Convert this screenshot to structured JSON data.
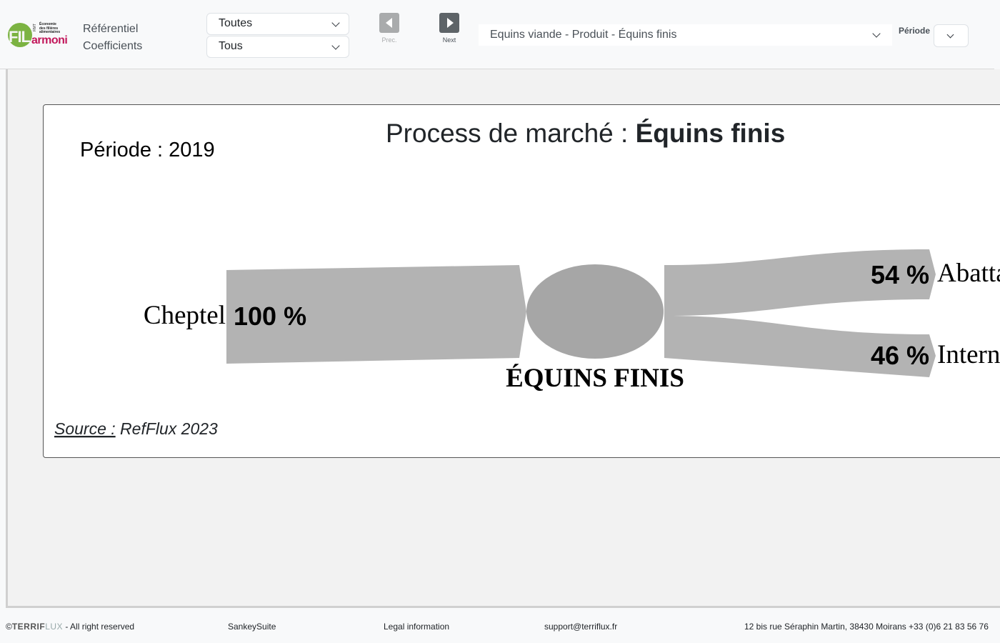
{
  "header": {
    "logo": {
      "badge": "FIL",
      "rmt": "RMT",
      "lines": [
        "Économie",
        "des filières",
        "alimentaires"
      ],
      "wordmark": "armoni"
    },
    "nav": {
      "referentiel": "Référentiel",
      "coefficients": "Coefficients"
    },
    "filter1": "Toutes",
    "filter2": "Tous",
    "prev_label": "Prec.",
    "next_label": "Next",
    "product_select": "Equins viande - Produit - Équins finis",
    "periode_label": "Période",
    "periode_value": ""
  },
  "diagram": {
    "period_label": "Période : 2019",
    "title_prefix": "Process de marché : ",
    "title_bold": "Équins finis",
    "node_label": "ÉQUINS FINIS",
    "source_label": "Source :",
    "source_value": " RefFlux 2023",
    "flows": {
      "input": {
        "label": "Cheptel",
        "percent": "100 %"
      },
      "out1": {
        "label": "Abattage",
        "percent": "54 %"
      },
      "out2": {
        "label": "International",
        "percent": "46 %"
      }
    },
    "colors": {
      "flow": "#b3b3b3",
      "node": "#a6a6a6"
    }
  },
  "footer": {
    "copyright_symbol": "©",
    "brand_main": "TERRIF",
    "brand_accent": "LUX",
    "rights": " - All right reserved",
    "suite": "SankeySuite",
    "legal": "Legal information",
    "email": "support@terriflux.fr",
    "address": "12 bis rue Séraphin Martin, 38430 Moirans +33 (0)6 21 83 56 76"
  }
}
